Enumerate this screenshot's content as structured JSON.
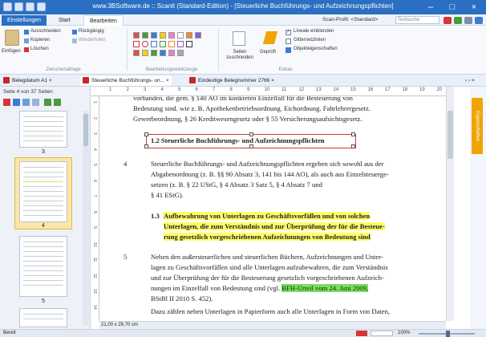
{
  "window": {
    "title": "www.3BSoftware.de :: Scanlt (Standard-Edition) - [Steuerliche Buchführungs- und Aufzeichnungspflichten]",
    "controls": [
      "–",
      "□",
      "×"
    ]
  },
  "menu": {
    "tabs": [
      "Einstellungen",
      "Start",
      "Bearbeiten"
    ],
    "scan_profile": "Scan-Profil: <Standard>",
    "search_placeholder": "Textsuche"
  },
  "ribbon": {
    "clipboard": {
      "paste": "Einfügen",
      "cut": "Ausschneiden",
      "copy": "Kopieren",
      "delete": "Löschen",
      "undo": "Rückgängig",
      "redo": "Wiederholen",
      "group": "Zwischenablage"
    },
    "tools": {
      "group": "Bearbeitungswerkzeuge"
    },
    "extras": {
      "crop": "Seiten zuschneiden",
      "checked": "Geprüft",
      "show_lines": "Lineale einblenden",
      "gridlines": "Gitternetzlinien",
      "object_props": "Objekteigenschaften",
      "group": "Extras"
    }
  },
  "doc_tabs": [
    {
      "label": "Belegdatum A1",
      "close": "×"
    },
    {
      "label": "Steuerliche Buchführungs- un...",
      "close": "×"
    },
    {
      "label": "Eindeutige Belegnummer 2766",
      "close": "×"
    }
  ],
  "doc_tabs_nav": "‹ › ×",
  "left_pane": {
    "page_info": "Seite 4 von 37 Seiten",
    "thumb_numbers": [
      "3",
      "4",
      "5"
    ]
  },
  "ruler": {
    "ticks": [
      "1",
      "2",
      "3",
      "4",
      "5",
      "6",
      "7",
      "8",
      "9",
      "10",
      "11",
      "12",
      "13",
      "14",
      "15",
      "16",
      "17",
      "18",
      "19",
      "20"
    ],
    "vticks": [
      "1",
      "2",
      "3",
      "4",
      "5",
      "6",
      "7",
      "8",
      "9",
      "10",
      "11",
      "12",
      "13",
      "14"
    ]
  },
  "right_panel": {
    "tab": "Eigenschaften"
  },
  "document": {
    "p0_line1": "vorhanden, die gem. § 140 AO im konkreten Einzelfall für die Besteuerung von",
    "p0_line2": "Bedeutung sind. wie z. B. Apothekenbetriebsordnung. Eichordnung. Fahrlehrergesetz.",
    "p0_line3": "Gewerbeordnung, § 26 Kreditwesengesetz oder § 55 Versicherungsaufsichtsgesetz.",
    "heading_1_2": "1.2 Steuerliche Buchführungs- und Aufzeichnungspflichten",
    "p4_num": "4",
    "p4_line1": "Steuerliche Buchführungs- und Aufzeichnungspflichten ergeben sich sowohl aus der",
    "p4_line2": "Abgabenordnung (z. B. §§ 90 Absatz 3, 141 bis 144 AO), als auch aus Einzelsteuerge-",
    "p4_line3": "setzen (z. B. § 22 UStG, § 4 Absatz 3 Satz 5, § 4 Absatz 7 und",
    "p4_line4": "§ 41 EStG).",
    "h13_num": "1.3",
    "h13_line1": "Aufbewahrung von Unterlagen zu Geschäftsvorfällen und von solchen",
    "h13_line2": "Unterlagen, die zum Verständnis und zur Überprüfung der für die Besteue-",
    "h13_line3": "rung gesetzlich vorgeschriebenen Aufzeichnungen von Bedeutung sind",
    "p5_num": "5",
    "p5_line1": "Neben den außersteuerlichen und steuerlichen Büchern, Aufzeichnungen und Unter-",
    "p5_line2": "lagen zu Geschäftsvorfällen sind alle Unterlagen aufzubewahren, die zum Verständnis",
    "p5_line3": "und zur Überprüfung der für die Besteuerung gesetzlich vorgeschriebenen Aufzeich-",
    "p5_line4a": "nungen im Einzelfall von Bedeutung sind (vgl. ",
    "p5_line4b": "BFH-Urteil vom 24. Juni 2009,",
    "p5_line5": "BStBl II 2010 S. 452).",
    "p5_line6": "Dazu zählen neben Unterlagen in Papierform auch alle Unterlagen in Form von Daten,"
  },
  "status": {
    "left": "Bereit",
    "page_size": "21,00 x 29,70 cm",
    "zoom": "100%"
  }
}
